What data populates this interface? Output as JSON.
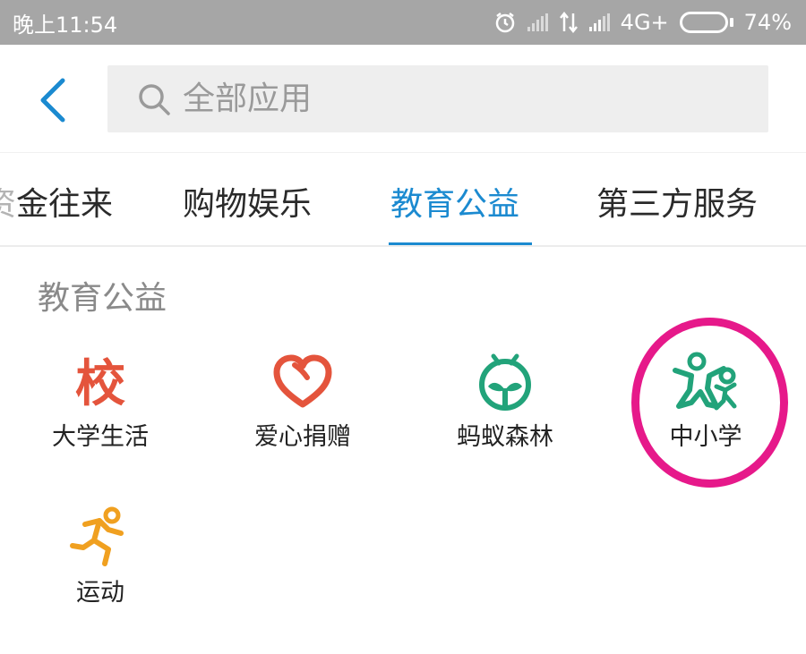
{
  "status_bar": {
    "time": "晚上11:54",
    "network": "4G+",
    "battery": "74%",
    "battery_level": 0.74
  },
  "header": {
    "back_icon": "chevron-left-icon",
    "search_icon": "search-icon",
    "search_placeholder": "全部应用",
    "search_value": ""
  },
  "tabs": [
    {
      "label": "金往来",
      "partial_prefix": "资",
      "active": false
    },
    {
      "label": "购物娱乐",
      "active": false
    },
    {
      "label": "教育公益",
      "active": true
    },
    {
      "label": "第三方服务",
      "active": false
    }
  ],
  "section": {
    "title": "教育公益",
    "apps": [
      {
        "label": "大学生活",
        "icon": "school-char-icon",
        "icon_text": "校",
        "color": "#e4543c"
      },
      {
        "label": "爱心捐赠",
        "icon": "heart-icon",
        "color": "#e4543c"
      },
      {
        "label": "蚂蚁森林",
        "icon": "sprout-icon",
        "color": "#22a37a"
      },
      {
        "label": "中小学",
        "icon": "kids-icon",
        "color": "#22a37a",
        "highlighted": true
      },
      {
        "label": "运动",
        "icon": "running-icon",
        "color": "#f0a020"
      }
    ]
  },
  "colors": {
    "accent": "#1b8ad0",
    "status_bar": "#a6a6a6",
    "highlight": "#e6198a"
  }
}
